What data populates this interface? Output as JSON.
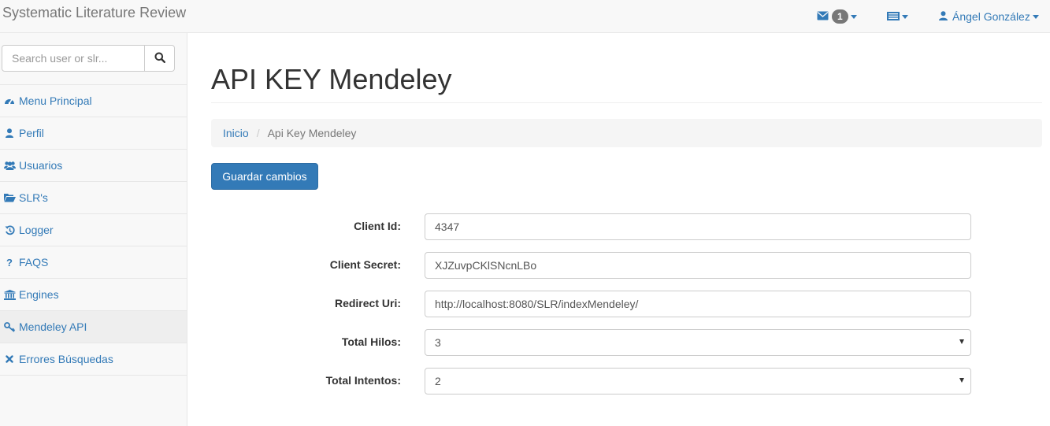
{
  "navbar": {
    "brand": "Systematic Literature Review",
    "mail_icon": "envelope-icon",
    "mail_count": "1",
    "flag_icon": "flag-icon",
    "user_icon": "user-icon",
    "user_name": "Ángel González"
  },
  "sidebar": {
    "search": {
      "placeholder": "Search user or slr...",
      "icon": "search-icon"
    },
    "items": [
      {
        "label": "Menu Principal",
        "icon": "dashboard-icon"
      },
      {
        "label": "Perfil",
        "icon": "user-icon"
      },
      {
        "label": "Usuarios",
        "icon": "users-icon"
      },
      {
        "label": "SLR's",
        "icon": "folder-open-icon"
      },
      {
        "label": "Logger",
        "icon": "history-icon"
      },
      {
        "label": "FAQS",
        "icon": "question-icon"
      },
      {
        "label": "Engines",
        "icon": "bank-icon"
      },
      {
        "label": "Mendeley API",
        "icon": "key-icon",
        "active": true
      },
      {
        "label": "Errores Búsquedas",
        "icon": "times-icon"
      }
    ]
  },
  "main": {
    "title": "API KEY Mendeley",
    "breadcrumb": {
      "home": "Inicio",
      "separator": "/",
      "current": "Api Key Mendeley"
    },
    "save_label": "Guardar cambios",
    "fields": [
      {
        "label": "Client Id:",
        "value": "4347",
        "type": "input"
      },
      {
        "label": "Client Secret:",
        "value": "XJZuvpCKlSNcnLBo",
        "type": "input"
      },
      {
        "label": "Redirect Uri:",
        "value": "http://localhost:8080/SLR/indexMendeley/",
        "type": "input"
      },
      {
        "label": "Total Hilos:",
        "value": "3",
        "type": "select"
      },
      {
        "label": "Total Intentos:",
        "value": "2",
        "type": "select"
      }
    ]
  },
  "colors": {
    "accent": "#337ab7",
    "navbar_bg": "#f8f8f8",
    "active_item_bg": "#eeeeee"
  }
}
